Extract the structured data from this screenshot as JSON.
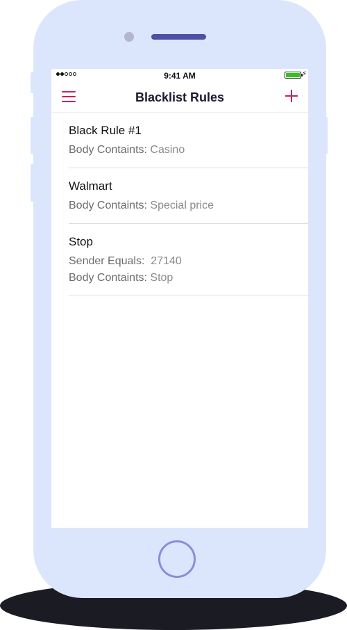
{
  "status_bar": {
    "time": "9:41 AM",
    "signal_dots": 5,
    "signal_filled": 2
  },
  "navbar": {
    "title": "Blacklist Rules",
    "menu_icon": "hamburger-menu-icon",
    "add_icon": "plus-icon"
  },
  "rules": [
    {
      "title": "Black Rule #1",
      "conditions": [
        {
          "label": "Body Containts: ",
          "value": "Casino"
        }
      ]
    },
    {
      "title": "Walmart",
      "conditions": [
        {
          "label": "Body Containts: ",
          "value": "Special price"
        }
      ]
    },
    {
      "title": "Stop",
      "conditions": [
        {
          "label": "Sender Equals: ",
          "value": " 27140"
        },
        {
          "label": "Body Containts: ",
          "value": "Stop"
        }
      ]
    }
  ],
  "colors": {
    "accent": "#d21d56",
    "device": "#dbe6fc",
    "home_ring": "#8a8dd8"
  }
}
